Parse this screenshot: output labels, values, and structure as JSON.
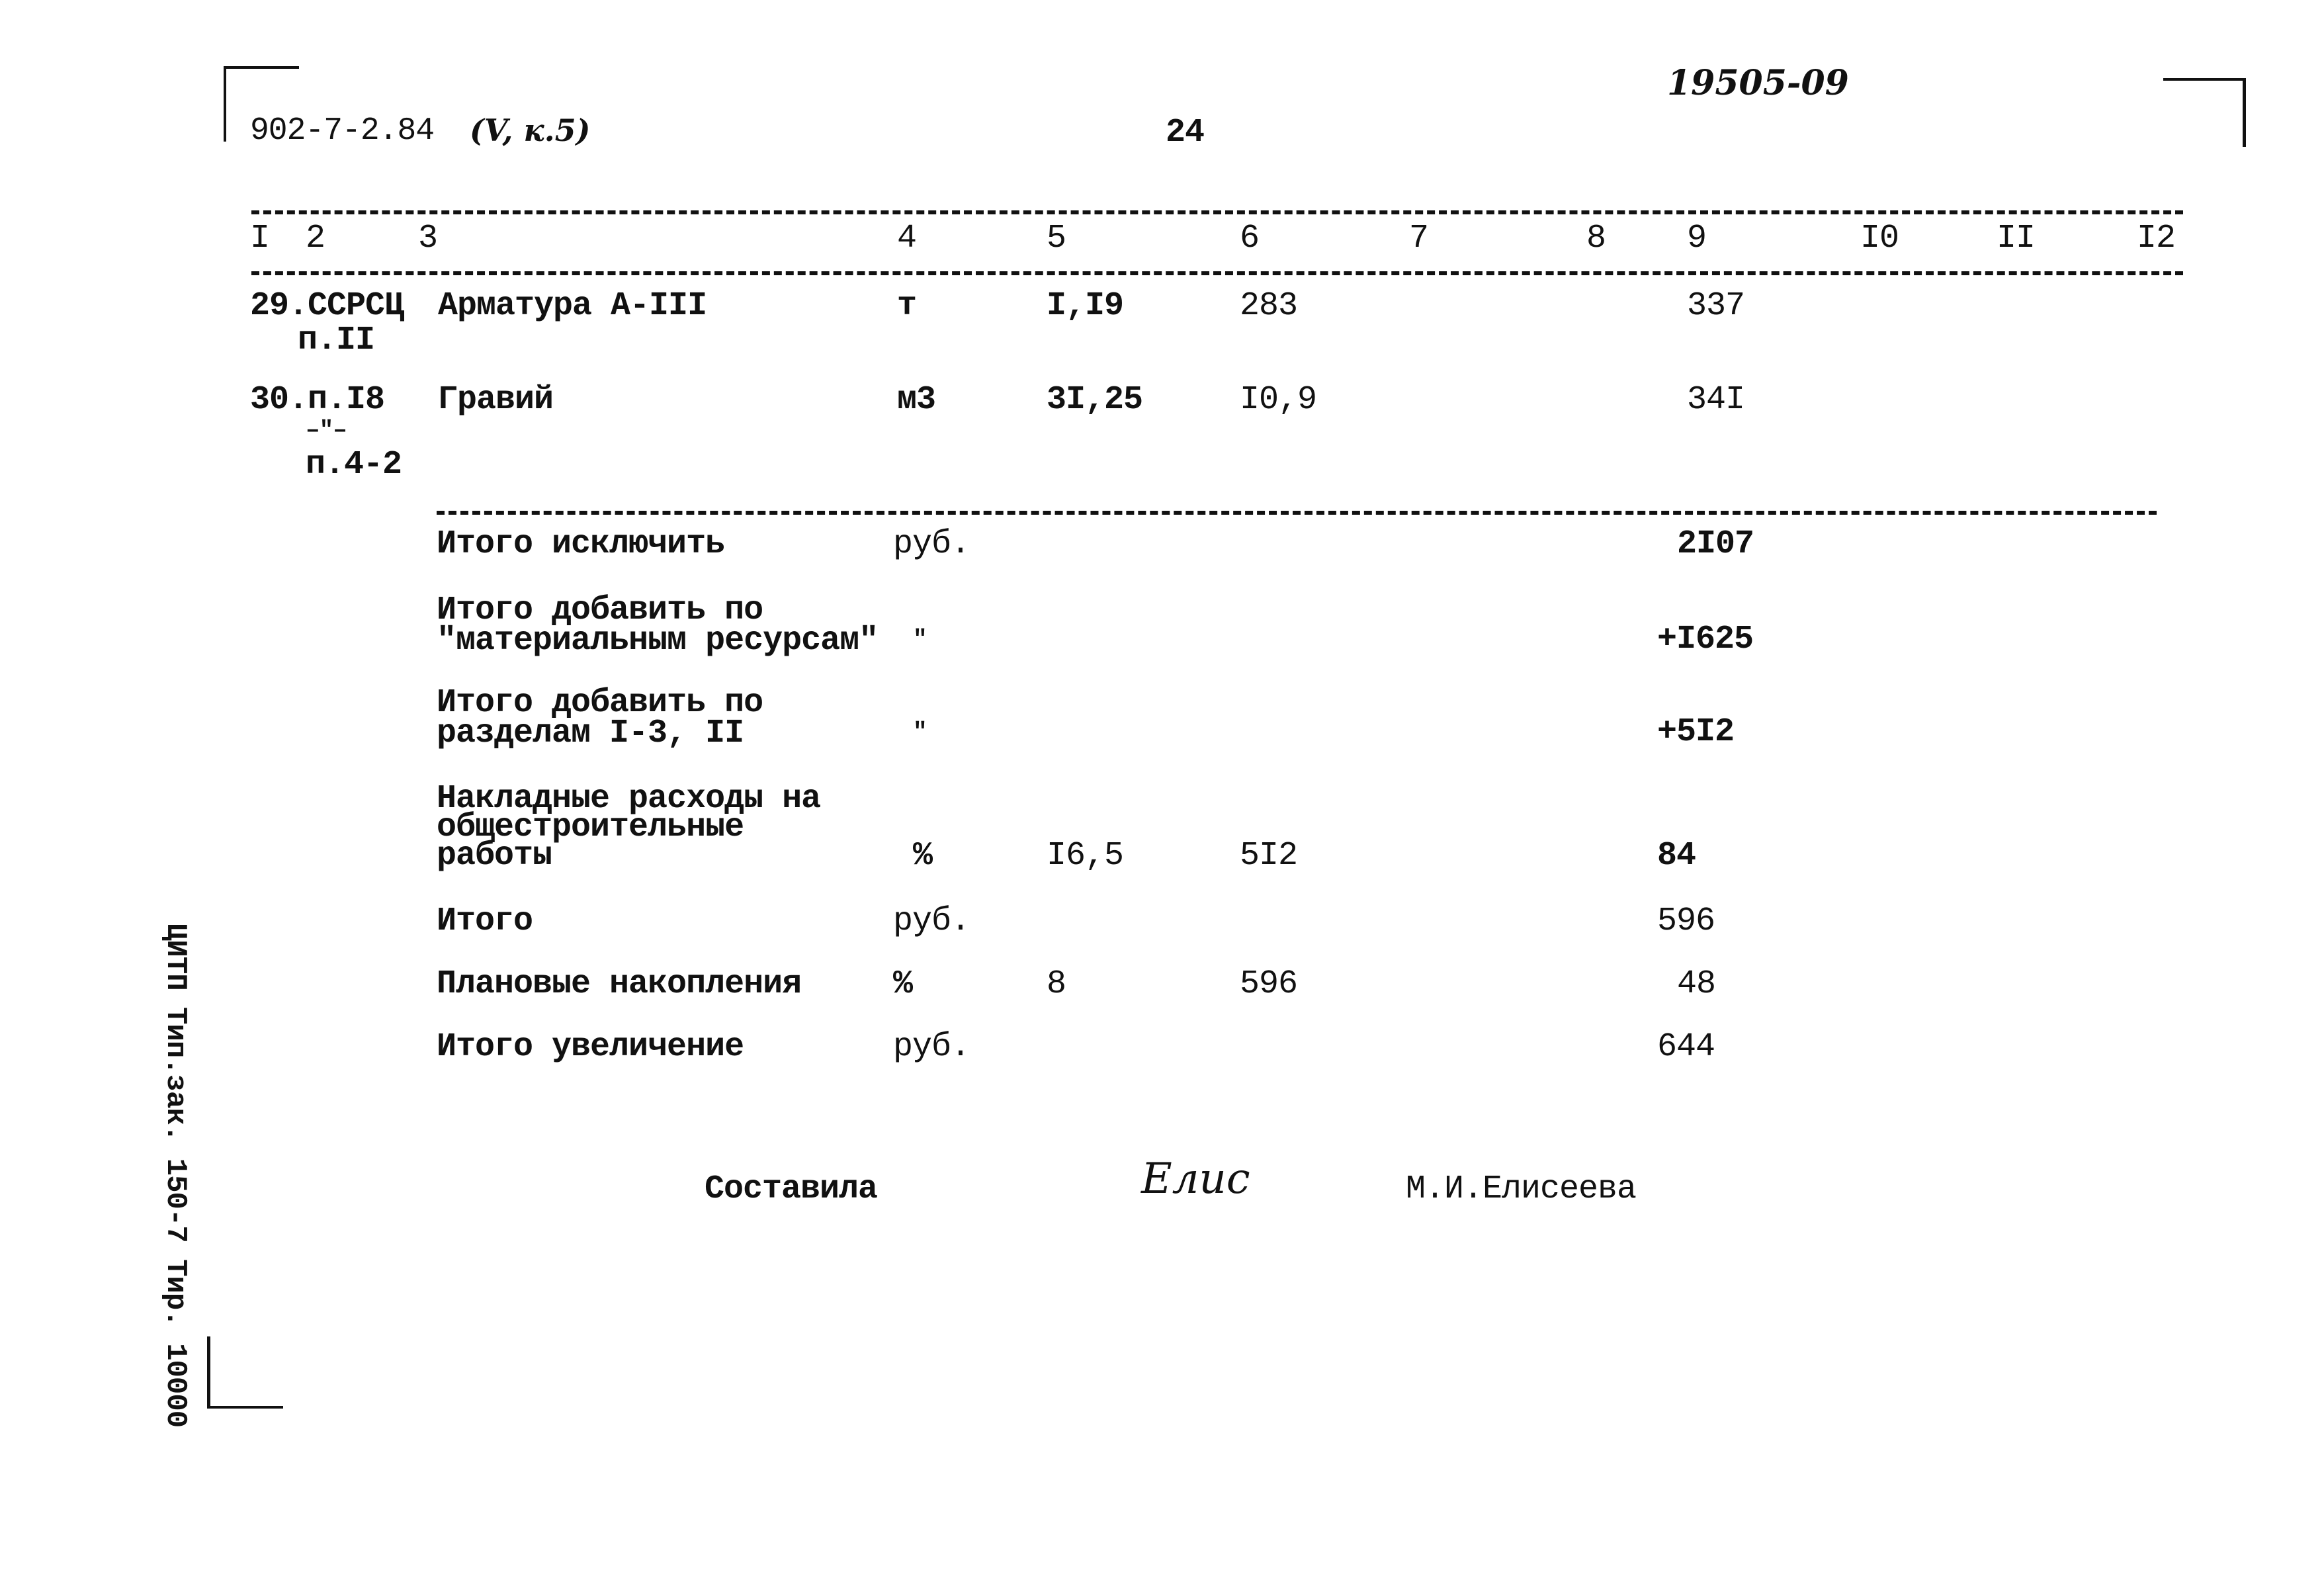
{
  "header": {
    "doc_code": "902-7-2.84",
    "doc_code_annotation": "(V, к.5)",
    "page_number": "24",
    "inventory_number": "19505-09"
  },
  "table": {
    "column_headers": [
      "I",
      "2",
      "3",
      "4",
      "5",
      "6",
      "7",
      "8",
      "9",
      "I0",
      "II",
      "I2"
    ],
    "rows": [
      {
        "ref_line1": "29.ССРСЦ",
        "ref_line2": "п.II",
        "name": "Арматура А-III",
        "unit": "т",
        "col5": "I,I9",
        "col6": "283",
        "col9": "337"
      },
      {
        "ref_line1": "30.п.I8",
        "ref_line2": "–\"–",
        "ref_line3": "п.4-2",
        "name": "Гравий",
        "unit": "м3",
        "col5": "3I,25",
        "col6": "I0,9",
        "col9": "34I"
      }
    ],
    "summary": [
      {
        "name": "Итого исключить",
        "unit": "руб.",
        "col5": "",
        "col6": "",
        "col9": "2I07"
      },
      {
        "name_line1": "Итого добавить по",
        "name_line2": "\"материальным ресурсам\"",
        "unit": "\"",
        "col5": "",
        "col6": "",
        "col9": "+I625"
      },
      {
        "name_line1": "Итого добавить по",
        "name_line2": "разделам I-3, II",
        "unit": "\"",
        "col5": "",
        "col6": "",
        "col9": "+5I2"
      },
      {
        "name_line1": "Накладные расходы на",
        "name_line2": "общестроительные",
        "name_line3": "работы",
        "unit": "%",
        "col5": "I6,5",
        "col6": "5I2",
        "col9": "84"
      },
      {
        "name": "Итого",
        "unit": "руб.",
        "col5": "",
        "col6": "",
        "col9": "596"
      },
      {
        "name": "Плановые накопления",
        "unit": "%",
        "col5": "8",
        "col6": "596",
        "col9": "48"
      },
      {
        "name": "Итого увеличение",
        "unit": "руб.",
        "col5": "",
        "col6": "",
        "col9": "644"
      }
    ]
  },
  "footer": {
    "compiled_label": "Составила",
    "signature": "Елис",
    "compiler_name": "М.И.Елисеева"
  },
  "margin_note": "ЦИТП Тип.зак. 150-7 Тир. 10000"
}
